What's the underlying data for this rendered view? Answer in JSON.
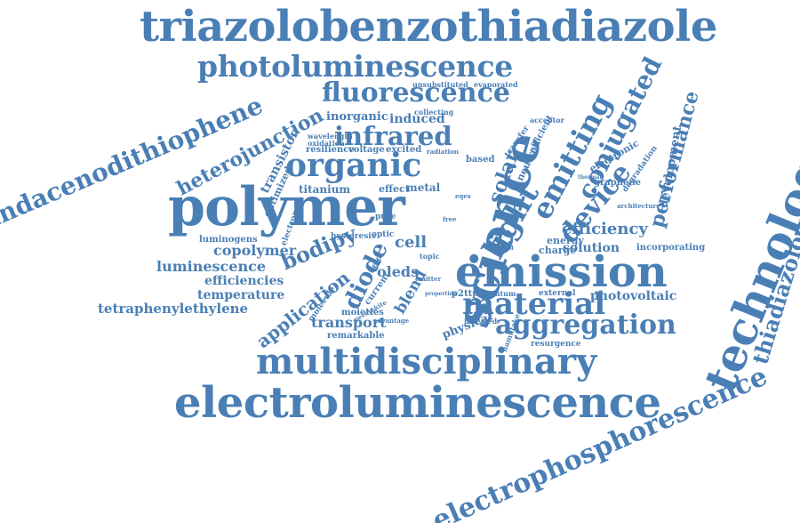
{
  "palette": {
    "word": "#4a7fb5",
    "background": "#ffffff"
  },
  "words": [
    "triazolobenzothiadiazole",
    "photoluminescence",
    "fluorescence",
    "indacenodithiophene",
    "heterojunction",
    "infrared",
    "organic",
    "polymer",
    "science",
    "emission",
    "technology",
    "electroluminescence",
    "multidisciplinary",
    "electrophosphorescence",
    "thiadiazoloquinoxaline",
    "light",
    "emitting",
    "conjugated",
    "device",
    "performance",
    "solar",
    "diode",
    "bodipy",
    "application",
    "material",
    "aggregation",
    "efficiency",
    "copolymer",
    "luminescence",
    "efficiencies",
    "temperature",
    "tetraphenylethylene",
    "transport",
    "photovoltaic",
    "solution",
    "development",
    "cell",
    "oleds",
    "blend",
    "inorganic",
    "induced",
    "transistor",
    "titanium",
    "resilience",
    "voltage",
    "excited",
    "metal",
    "effect",
    "based",
    "neutron",
    "electronic",
    "graphene",
    "degradation",
    "luminogens",
    "hysteresis",
    "energy",
    "charge",
    "incorporating",
    "p2ttpd",
    "quantum",
    "external",
    "physical",
    "inverted",
    "moieties",
    "remarkable",
    "resurgence",
    "unsubstituted",
    "evaporated",
    "wavelength",
    "oxidation",
    "collecting",
    "acceptor",
    "transfer",
    "efficient",
    "radiation",
    "optimized",
    "electron",
    "molecule",
    "current",
    "field",
    "optic",
    "pure",
    "topic",
    "hybrid",
    "emitter",
    "architecture",
    "eqes",
    "free",
    "perovskite",
    "advantage",
    "namutake",
    "properties",
    "thermal"
  ]
}
